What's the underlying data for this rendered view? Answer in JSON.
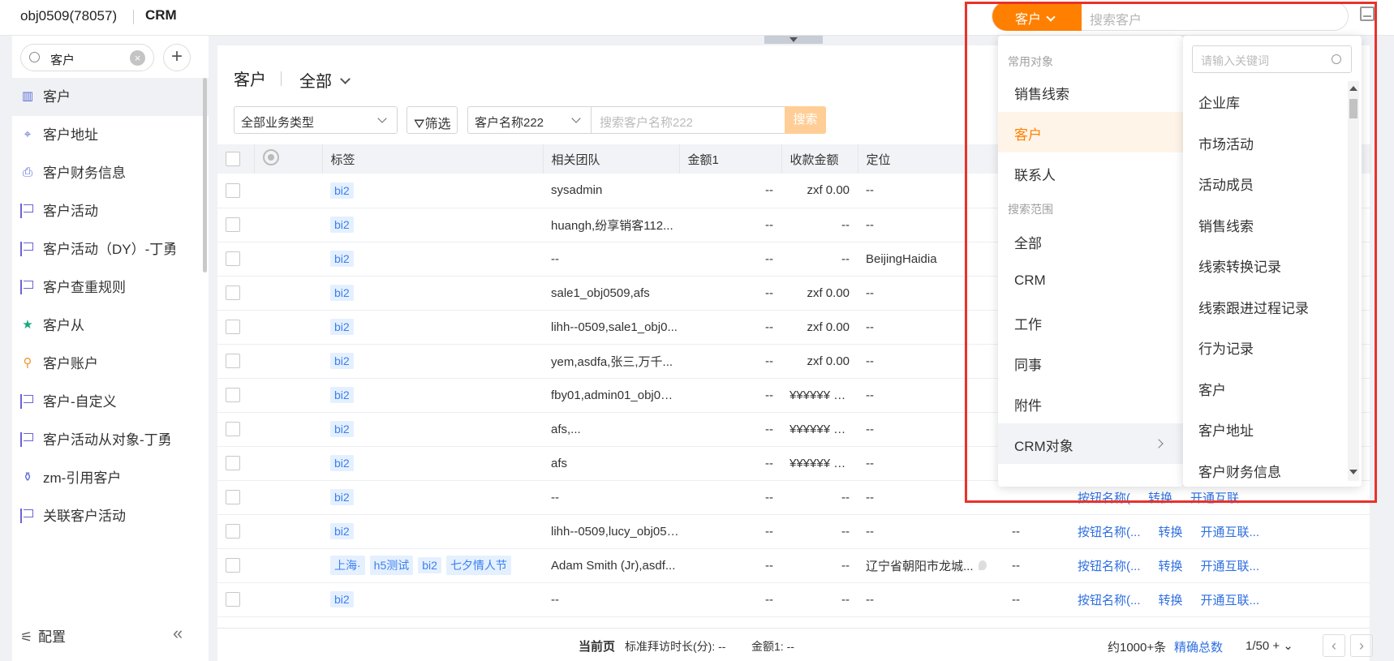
{
  "header": {
    "tenant": "obj0509(78057)",
    "app": "CRM",
    "search_scope": "客户",
    "search_placeholder": "搜索客户"
  },
  "sidebar": {
    "search_value": "客户",
    "items": [
      {
        "label": "客户",
        "icon": "building-icon",
        "active": true
      },
      {
        "label": "客户地址",
        "icon": "address-icon"
      },
      {
        "label": "客户财务信息",
        "icon": "finance-icon"
      },
      {
        "label": "客户活动",
        "icon": "flag-icon"
      },
      {
        "label": "客户活动（DY）-丁勇",
        "icon": "flag-icon"
      },
      {
        "label": "客户查重规则",
        "icon": "flag-icon"
      },
      {
        "label": "客户从",
        "icon": "folder-star-icon"
      },
      {
        "label": "客户账户",
        "icon": "wrench-icon"
      },
      {
        "label": "客户-自定义",
        "icon": "flag-icon"
      },
      {
        "label": "客户活动从对象-丁勇",
        "icon": "flag-icon"
      },
      {
        "label": "zm-引用客户",
        "icon": "tube-icon"
      },
      {
        "label": "关联客户活动",
        "icon": "flag-icon"
      }
    ],
    "config_label": "配置"
  },
  "main": {
    "title": "客户",
    "view": "全部",
    "biz_type": "全部业务类型",
    "filter_label": "筛选",
    "search_field": "客户名称222",
    "search_placeholder": "搜索客户名称222",
    "search_button": "搜索",
    "columns": [
      "标签",
      "相关团队",
      "金额1",
      "收款金额",
      "定位"
    ],
    "rows": [
      {
        "tags": [
          "bi2"
        ],
        "team": "sysadmin",
        "amount": "--",
        "received": "zxf 0.00",
        "location": "--"
      },
      {
        "tags": [
          "bi2"
        ],
        "team": "huangh,纷享销客112...",
        "amount": "--",
        "received": "--",
        "location": "--"
      },
      {
        "tags": [
          "bi2"
        ],
        "team": "--",
        "amount": "--",
        "received": "--",
        "location": "BeijingHaidia"
      },
      {
        "tags": [
          "bi2"
        ],
        "team": "sale1_obj0509,afs",
        "amount": "--",
        "received": "zxf 0.00",
        "location": "--"
      },
      {
        "tags": [
          "bi2"
        ],
        "team": "lihh--0509,sale1_obj0...",
        "amount": "--",
        "received": "zxf 0.00",
        "location": "--"
      },
      {
        "tags": [
          "bi2"
        ],
        "team": "yem,asdfa,张三,万千...",
        "amount": "--",
        "received": "zxf 0.00",
        "location": "--"
      },
      {
        "tags": [
          "bi2"
        ],
        "team": "fby01,admin01_obj0509",
        "amount": "--",
        "received": "¥¥¥¥¥¥ 0...",
        "location": "--"
      },
      {
        "tags": [
          "bi2"
        ],
        "team": "afs,...",
        "amount": "--",
        "received": "¥¥¥¥¥¥ 0...",
        "location": "--"
      },
      {
        "tags": [
          "bi2"
        ],
        "team": "afs",
        "amount": "--",
        "received": "¥¥¥¥¥¥ 0...",
        "location": "--"
      },
      {
        "tags": [
          "bi2"
        ],
        "team": "--",
        "amount": "--",
        "received": "--",
        "location": "--",
        "col6": "",
        "actions": [
          "按钮名称(",
          "转换",
          "开通互联..."
        ]
      },
      {
        "tags": [
          "bi2"
        ],
        "team": "lihh--0509,lucy_obj0509",
        "amount": "--",
        "received": "--",
        "location": "--",
        "col6": "--",
        "actions": [
          "按钮名称(...",
          "转换",
          "开通互联..."
        ]
      },
      {
        "tags": [
          "上海·",
          "h5测试",
          "bi2",
          "七夕情人节"
        ],
        "team": "Adam Smith (Jr),asdf...",
        "amount": "--",
        "received": "--",
        "location": "辽宁省朝阳市龙城...",
        "col6": "--",
        "actions": [
          "按钮名称(...",
          "转换",
          "开通互联..."
        ]
      },
      {
        "tags": [
          "bi2"
        ],
        "team": "--",
        "amount": "--",
        "received": "--",
        "location": "--",
        "col6": "--",
        "actions": [
          "按钮名称(...",
          "转换",
          "开通互联..."
        ]
      }
    ],
    "footer": {
      "current_page": "当前页",
      "avg_visit": "标准拜访时长(分): --",
      "amount_sum": "金额1: --",
      "total": "约1000+条",
      "exact": "精确总数",
      "page_size": "1/50 +"
    }
  },
  "dropdown": {
    "group_common": "常用对象",
    "common": [
      "销售线索",
      "客户",
      "联系人"
    ],
    "active": "客户",
    "group_scope": "搜索范围",
    "scopes": [
      "全部",
      "CRM",
      "工作",
      "同事",
      "附件",
      "CRM对象"
    ],
    "keyword_placeholder": "请输入关键词",
    "objects": [
      "企业库",
      "市场活动",
      "活动成员",
      "销售线索",
      "线索转换记录",
      "线索跟进过程记录",
      "行为记录",
      "客户",
      "客户地址",
      "客户财务信息"
    ],
    "accent": "#ff8000"
  }
}
